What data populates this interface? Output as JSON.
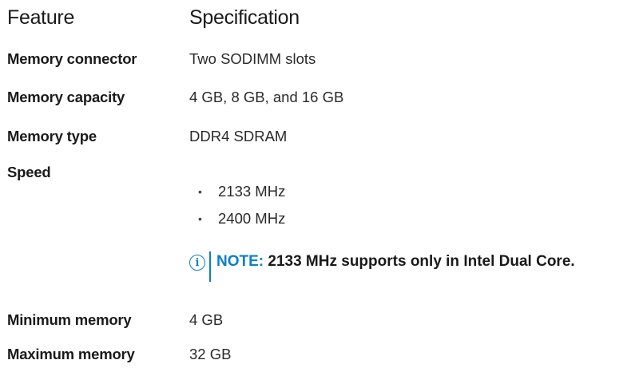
{
  "header": {
    "feature": "Feature",
    "specification": "Specification"
  },
  "rows": [
    {
      "label": "Memory connector",
      "value": "Two SODIMM slots"
    },
    {
      "label": "Memory capacity",
      "value": "4 GB, 8 GB, and 16 GB"
    },
    {
      "label": "Memory type",
      "value": "DDR4 SDRAM"
    },
    {
      "label": "Speed",
      "value": ""
    },
    {
      "label": "Minimum memory",
      "value": "4 GB"
    },
    {
      "label": "Maximum memory",
      "value": "32 GB"
    }
  ],
  "speed_bullets": [
    "2133 MHz",
    "2400 MHz"
  ],
  "note": {
    "icon": "info-icon",
    "label": "NOTE:",
    "text": "2133 MHz supports only in Intel Dual Core.",
    "color": "#0b7fc7"
  }
}
